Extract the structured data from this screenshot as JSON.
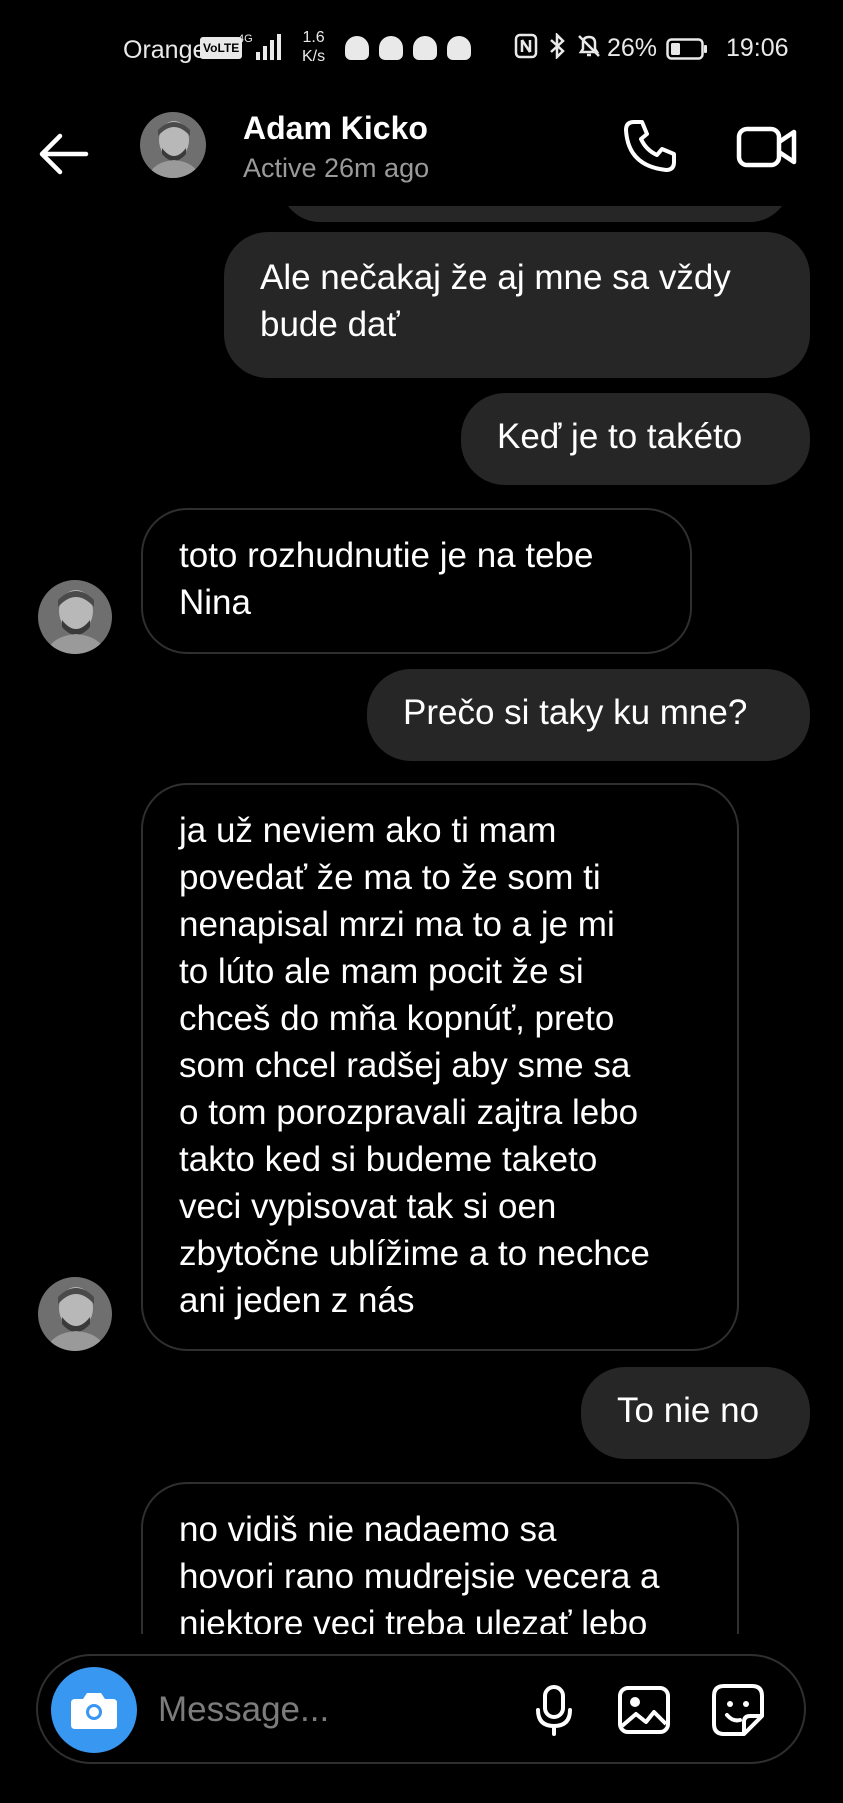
{
  "status_bar": {
    "carrier": "Orange",
    "volte": "VoLTE",
    "network_speed_value": "1.6",
    "network_speed_unit": "K/s",
    "battery_percent": "26%",
    "time": "19:06"
  },
  "header": {
    "contact_name": "Adam Kicko",
    "contact_status": "Active 26m ago"
  },
  "messages": [
    {
      "direction": "sent",
      "text": "Ale nečakaj že aj mne sa vždy\nbude dať"
    },
    {
      "direction": "sent",
      "text": "Keď je to takéto"
    },
    {
      "direction": "received",
      "text": "toto rozhudnutie je na tebe\nNina"
    },
    {
      "direction": "sent",
      "text": "Prečo si taky ku mne?"
    },
    {
      "direction": "received",
      "text": "ja už neviem ako ti mam\npovedať že ma to že som ti\nnenapisal mrzi  ma to a je mi\nto lúto ale mam pocit že si\nchceš do mňa kopnúť, preto\nsom chcel radšej aby sme sa\no tom porozpravali zajtra lebo\ntakto ked si budeme taketo\nveci vypisovat tak si oen\nzbytočne ublížime a to nechce\nani jeden z nás"
    },
    {
      "direction": "sent",
      "text": "To nie no"
    },
    {
      "direction": "received",
      "text": "no vidiš nie nadaemo sa\nhovori rano mudrejsie vecera a\nniektore veci treba ulezať lebo"
    }
  ],
  "composer": {
    "placeholder": "Message..."
  },
  "colors": {
    "background": "#000000",
    "sent_bubble": "#262626",
    "received_border": "#2f2f2f",
    "accent_camera": "#3897f0",
    "secondary_text": "#9a9a9a"
  },
  "icons": {
    "back": "arrow-left-icon",
    "call": "phone-icon",
    "video": "video-camera-icon",
    "camera": "camera-icon",
    "mic": "microphone-icon",
    "gallery": "image-icon",
    "sticker": "sticker-icon"
  }
}
